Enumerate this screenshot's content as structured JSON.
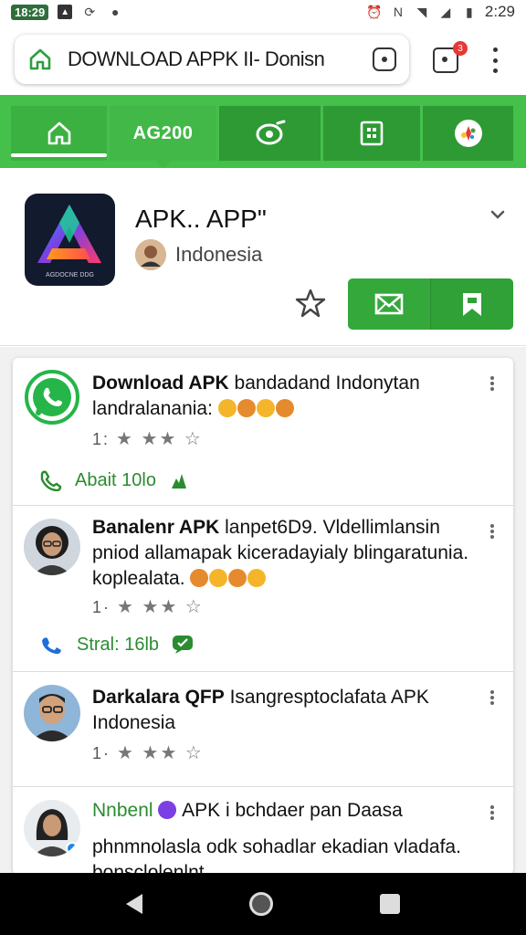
{
  "status_bar": {
    "time_badge": "18:29",
    "clock": "2:29"
  },
  "browser": {
    "url_text": "DOWNLOAD APPK II- Donisn",
    "tab_badge": "3"
  },
  "green_nav": {
    "tabs": [
      {
        "icon": "home-icon",
        "label": ""
      },
      {
        "icon": "",
        "label": "AG200"
      },
      {
        "icon": "camera-icon",
        "label": ""
      },
      {
        "icon": "grid-icon",
        "label": ""
      },
      {
        "icon": "colorful-logo-icon",
        "label": ""
      }
    ]
  },
  "app": {
    "title": "APK.. APP\"",
    "region": "Indonesia",
    "icon_caption": "AGDOCNE DDG",
    "colors": {
      "primary_green": "#35a83c",
      "nav_green": "#45c04b"
    }
  },
  "posts": [
    {
      "title_bold": "Download APK",
      "title_rest": " bandadand Indonytan landralanania: ",
      "rating_prefix": "1:",
      "meta_text": "Abait 10lo",
      "meta_icon": "phone-icon",
      "meta_icon_right": "pin-icon"
    },
    {
      "title_bold": "Banalenr APK",
      "title_rest": " lanpet6D9. Vldellimlansin pniod allamapak kiceradayialy blingaratunia. koplealata. ",
      "rating_prefix": "1·",
      "meta_text": "Stral: 16lb",
      "meta_icon": "share-icon",
      "meta_icon_right": "chat-icon"
    },
    {
      "title_bold": "Darkalara QFP",
      "title_rest": " Isangresptoclafata APK Indonesia",
      "rating_prefix": "1·"
    },
    {
      "title_bold": "Nnbenl",
      "title_rest": " APK i bchdaer pan Daasa",
      "subtitle": "phnmnolasla odk sohadlar ekadian vladafa. bonsclolenlnt"
    }
  ]
}
